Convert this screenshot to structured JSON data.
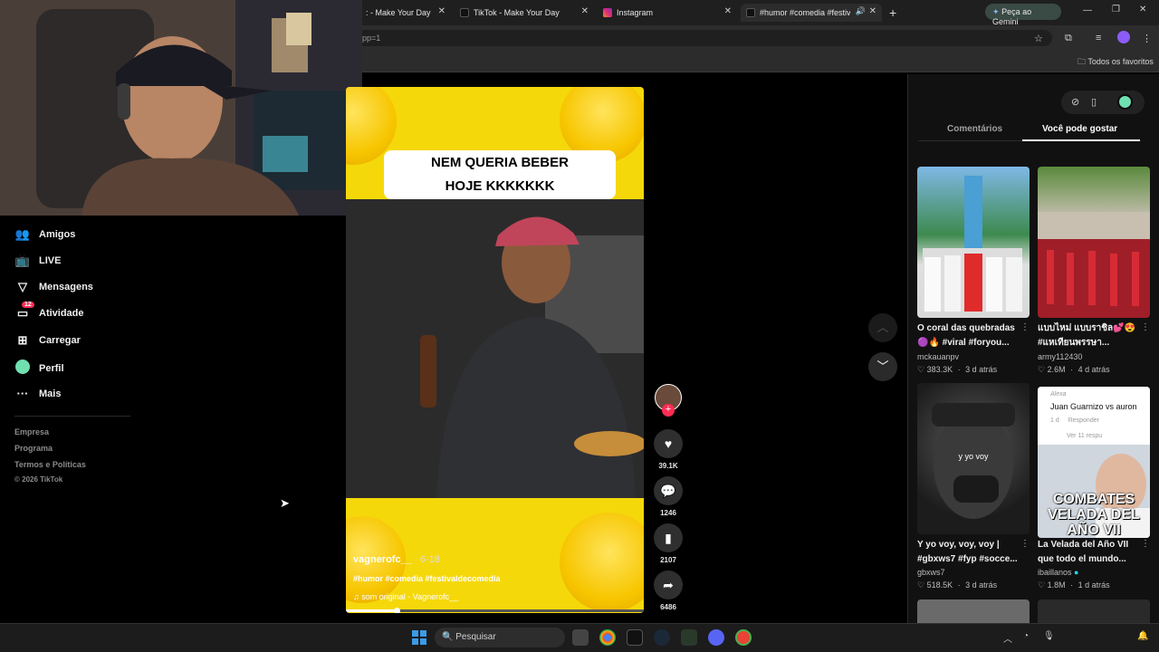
{
  "tabs": [
    {
      "label": ": - Make Your Day",
      "icon": "tiktok-icon"
    },
    {
      "label": "TikTok - Make Your Day",
      "icon": "tiktok-icon"
    },
    {
      "label": "Instagram",
      "icon": "instagram-icon"
    },
    {
      "label": "#humor #comedia #festival",
      "icon": "tiktok-icon"
    }
  ],
  "browser": {
    "omnibox_text": "pp=1",
    "gemini_label": "Peça ao Gemini",
    "bookmarks_all": "Todos os favoritos"
  },
  "sidebar": {
    "items": [
      {
        "label": "Amigos",
        "icon": "friends-icon"
      },
      {
        "label": "LIVE",
        "icon": "live-icon"
      },
      {
        "label": "Mensagens",
        "icon": "messages-icon"
      },
      {
        "label": "Atividade",
        "icon": "activity-icon",
        "badge": "12"
      },
      {
        "label": "Carregar",
        "icon": "upload-icon"
      },
      {
        "label": "Perfil",
        "icon": "profile-icon"
      },
      {
        "label": "Mais",
        "icon": "more-icon"
      }
    ],
    "footer": [
      "Empresa",
      "Programa",
      "Termos e Políticas",
      "© 2026 TikTok"
    ]
  },
  "video": {
    "caption_line1": "NEM QUERIA BEBER",
    "caption_line2": "HOJE KKKKKKK",
    "author": "vagnerofc__",
    "date": "6-18",
    "hashtags": "#humor #comedia #festivaldecomedia",
    "sound": "som original - Vagnerofc__",
    "progress": 0.17
  },
  "actions": {
    "likes": "39.1K",
    "comments": "1246",
    "saves": "2107",
    "shares": "6486"
  },
  "panel": {
    "tab_comments": "Comentários",
    "tab_suggested": "Você pode gostar",
    "cards": [
      {
        "title": "O coral das quebradas 🟣🔥 #viral #foryou...",
        "user": "mckauanpv",
        "likes": "383.3K",
        "age": "3 d atrás",
        "overlay": ""
      },
      {
        "title": "แบบไหม่ แบบราชิล💕😍 #แหเทียนพรรษา...",
        "user": "army112430",
        "likes": "2.6M",
        "age": "4 d atrás",
        "overlay": ""
      },
      {
        "title": "Y yo voy, voy, voy | #gbxws7 #fyp #socce...",
        "user": "gbxws7",
        "likes": "518.5K",
        "age": "3 d atrás",
        "overlay": "y yo voy"
      },
      {
        "title": "La Velada del Año VII que todo el mundo...",
        "user": "ibaillanos",
        "likes": "1.8M",
        "age": "1 d atrás",
        "overlay": "COMBATES\nVELADA DEL AÑO VII"
      }
    ],
    "card4_comment_user": "Alexa",
    "card4_comment_text": "Juan Guarnizo vs auron",
    "card4_comment_meta": "1 d",
    "card4_reply": "Responder",
    "card4_more": "Ver 11 respu"
  },
  "taskbar": {
    "search_placeholder": "Pesquisar"
  },
  "colors": {
    "accent": "#fe2c55",
    "yellow": "#f5d80a",
    "profile_dot": "#6fe0b0"
  }
}
